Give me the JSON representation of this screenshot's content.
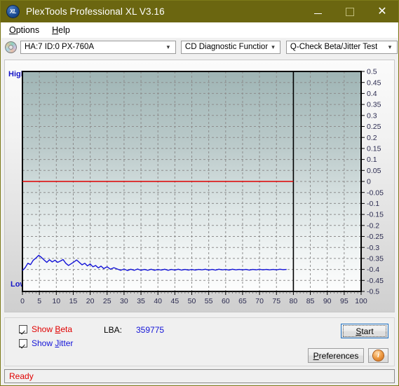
{
  "window": {
    "title": "PlexTools Professional XL V3.16",
    "app_icon": "xl-app-icon",
    "minimize_label": "–",
    "maximize_label": "",
    "close_label": "✕"
  },
  "menubar": {
    "items": [
      {
        "label": "Options",
        "accel": "O"
      },
      {
        "label": "Help",
        "accel": "H"
      }
    ]
  },
  "toolbar": {
    "disc_icon": "cd-disc-icon",
    "drive": {
      "value": "HA:7 ID:0  PX-760A",
      "arrow": "⌄"
    },
    "function": {
      "value": "CD Diagnostic Functions",
      "arrow": "⌄"
    },
    "test": {
      "value": "Q-Check Beta/Jitter Test",
      "arrow": "⌄"
    }
  },
  "chart_data": {
    "type": "line",
    "title": "",
    "xlabel": "",
    "ylabel": "",
    "high_label": "High",
    "low_label": "Low",
    "xlim": [
      0,
      100
    ],
    "ylim": [
      -0.5,
      0.5
    ],
    "xticks": [
      0,
      5,
      10,
      15,
      20,
      25,
      30,
      35,
      40,
      45,
      50,
      55,
      60,
      65,
      70,
      75,
      80,
      85,
      90,
      95,
      100
    ],
    "yticks": [
      0.5,
      0.45,
      0.4,
      0.35,
      0.3,
      0.25,
      0.2,
      0.15,
      0.1,
      0.05,
      0,
      -0.05,
      -0.1,
      -0.15,
      -0.2,
      -0.25,
      -0.3,
      -0.35,
      -0.4,
      -0.45,
      -0.5
    ],
    "grid": true,
    "grid_style": "dashed",
    "data_end_x": 80,
    "marker_line_x": 80,
    "series": [
      {
        "name": "Beta",
        "color": "#e00000",
        "x": [
          0,
          2,
          4,
          6,
          8,
          10,
          12,
          14,
          16,
          18,
          20,
          22,
          24,
          26,
          28,
          30,
          32,
          34,
          36,
          38,
          40,
          42,
          44,
          46,
          48,
          50,
          52,
          54,
          56,
          58,
          60,
          62,
          64,
          66,
          68,
          70,
          72,
          74,
          76,
          78,
          80
        ],
        "values": [
          0,
          0,
          0,
          0,
          0,
          0,
          0,
          0,
          0,
          0,
          0,
          0,
          0,
          0,
          0,
          0,
          0,
          0,
          0,
          0,
          0,
          0,
          0,
          0,
          0,
          0,
          0,
          0,
          0,
          0,
          0,
          0,
          0,
          0,
          0,
          0,
          0,
          0,
          0,
          0,
          0
        ]
      },
      {
        "name": "Jitter",
        "color": "#1414d8",
        "x": [
          0,
          0.8,
          1.6,
          2.4,
          3.2,
          4,
          4.8,
          5.6,
          6.4,
          7.2,
          8,
          8.8,
          9.6,
          10.4,
          11.2,
          12,
          12.8,
          13.6,
          14.4,
          15.2,
          16,
          16.8,
          17.6,
          18.4,
          19.2,
          20,
          20.8,
          21.6,
          22.4,
          23.2,
          24,
          25,
          26,
          27,
          28,
          29,
          30,
          31,
          32,
          33,
          34,
          35,
          36,
          37,
          38,
          39,
          40,
          41,
          42,
          43,
          44,
          45,
          46,
          47,
          48,
          49,
          50,
          51,
          52,
          53,
          54,
          55,
          56,
          57,
          58,
          59,
          60,
          61,
          62,
          63,
          64,
          65,
          66,
          67,
          68,
          69,
          70,
          71,
          72,
          73,
          74,
          75,
          76,
          77,
          78,
          79,
          80
        ],
        "values": [
          -0.405,
          -0.392,
          -0.372,
          -0.378,
          -0.358,
          -0.348,
          -0.336,
          -0.345,
          -0.357,
          -0.368,
          -0.356,
          -0.366,
          -0.358,
          -0.368,
          -0.362,
          -0.355,
          -0.372,
          -0.382,
          -0.374,
          -0.366,
          -0.357,
          -0.368,
          -0.379,
          -0.372,
          -0.384,
          -0.375,
          -0.388,
          -0.382,
          -0.393,
          -0.385,
          -0.396,
          -0.388,
          -0.399,
          -0.392,
          -0.398,
          -0.404,
          -0.398,
          -0.405,
          -0.399,
          -0.404,
          -0.398,
          -0.404,
          -0.4,
          -0.404,
          -0.399,
          -0.404,
          -0.4,
          -0.403,
          -0.399,
          -0.404,
          -0.4,
          -0.403,
          -0.399,
          -0.403,
          -0.4,
          -0.403,
          -0.4,
          -0.403,
          -0.4,
          -0.402,
          -0.399,
          -0.403,
          -0.4,
          -0.403,
          -0.399,
          -0.402,
          -0.4,
          -0.403,
          -0.399,
          -0.402,
          -0.4,
          -0.402,
          -0.4,
          -0.403,
          -0.4,
          -0.402,
          -0.399,
          -0.402,
          -0.4,
          -0.402,
          -0.4,
          -0.402,
          -0.399,
          -0.401,
          -0.4
        ]
      }
    ]
  },
  "controls": {
    "show_beta": {
      "label_pre": "Show ",
      "accel": "B",
      "label_post": "eta",
      "checked": true
    },
    "show_jitter": {
      "label_pre": "Show ",
      "accel": "J",
      "label_post": "itter",
      "checked": true
    },
    "lba_key": "LBA:",
    "lba_value": "359775",
    "start": {
      "pre": "",
      "accel": "S",
      "post": "tart"
    },
    "preferences": {
      "pre": "",
      "accel": "P",
      "post": "references"
    },
    "info_icon": "info-icon",
    "info_glyph": "i"
  },
  "statusbar": {
    "text": "Ready"
  }
}
